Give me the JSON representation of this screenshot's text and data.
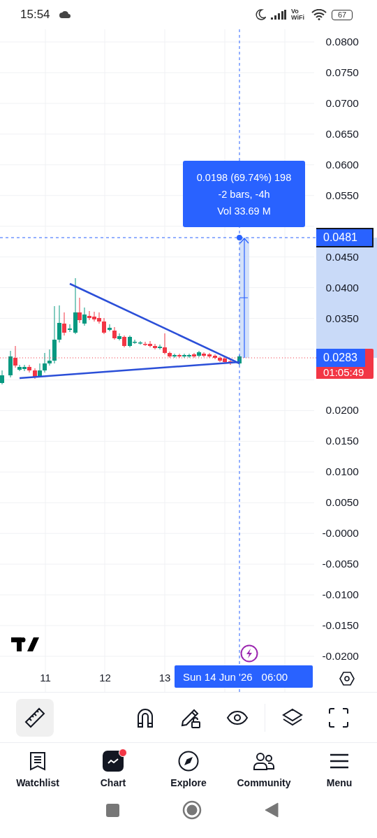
{
  "status_bar": {
    "time": "15:54",
    "network": "Vo WiFi",
    "battery": "67"
  },
  "price_scale": [
    "0.0800",
    "0.0750",
    "0.0700",
    "0.0650",
    "0.0600",
    "0.0550",
    "0.0450",
    "0.0400",
    "0.0350",
    "0.0200",
    "0.0150",
    "0.0100",
    "0.0050",
    "-0.0000",
    "-0.0050",
    "-0.0100",
    "-0.0150",
    "-0.0200"
  ],
  "time_scale": [
    "11",
    "12",
    "13"
  ],
  "measure_tooltip": {
    "lines": [
      "0.0198 (69.74%) 198",
      "-2 bars, -4h",
      "Vol 33.69 M"
    ]
  },
  "crosshair_price": "0.0481",
  "last_price": {
    "price": "0.0283",
    "countdown": "01:05:49"
  },
  "crosshair_time": {
    "date": "Sun 14 Jun '26",
    "time": "06:00"
  },
  "tools": [
    {
      "kind": "ruler",
      "selected": true
    },
    {
      "kind": "magnet",
      "selected": false
    },
    {
      "kind": "draw-lock",
      "selected": false
    },
    {
      "kind": "eye",
      "selected": false
    },
    {
      "kind": "layers",
      "selected": false
    },
    {
      "kind": "fullscreen",
      "selected": false
    }
  ],
  "nav": [
    {
      "kind": "watchlist",
      "label": "Watchlist",
      "selected": false,
      "notification": false
    },
    {
      "kind": "chart",
      "label": "Chart",
      "selected": true,
      "notification": true
    },
    {
      "kind": "explore",
      "label": "Explore",
      "selected": false,
      "notification": false
    },
    {
      "kind": "community",
      "label": "Community",
      "selected": false,
      "notification": false
    },
    {
      "kind": "menu",
      "label": "Menu",
      "selected": false,
      "notification": false
    }
  ]
}
